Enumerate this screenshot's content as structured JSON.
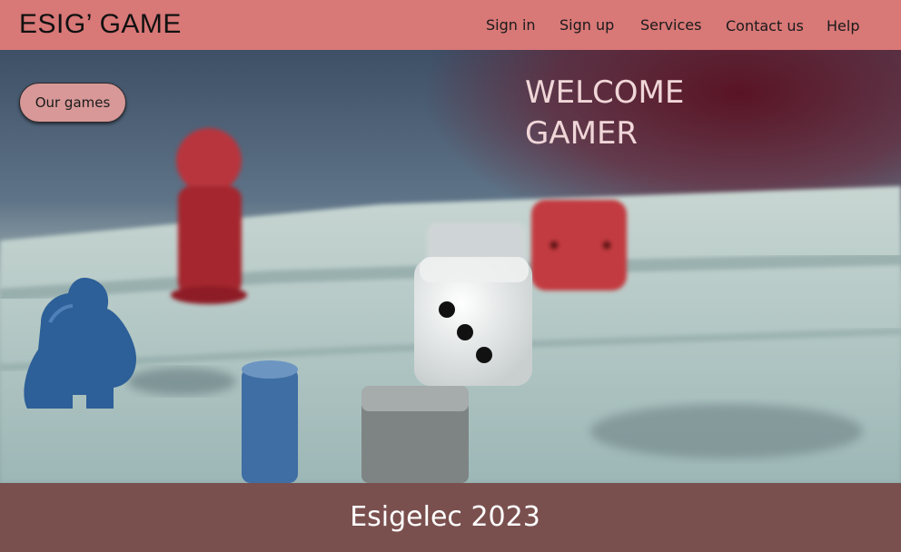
{
  "header": {
    "brand": "ESIG’ GAME",
    "nav": [
      "Sign in",
      "Sign up",
      "Services",
      "Contact us",
      "Help"
    ]
  },
  "hero": {
    "games_button": "Our games",
    "welcome_line1": "WELCOME",
    "welcome_line2": "GAMER"
  },
  "footer": {
    "text": "Esigelec 2023"
  },
  "colors": {
    "header_bg": "#d87877",
    "button_bg": "#d89898",
    "footer_bg": "#7a504f"
  }
}
